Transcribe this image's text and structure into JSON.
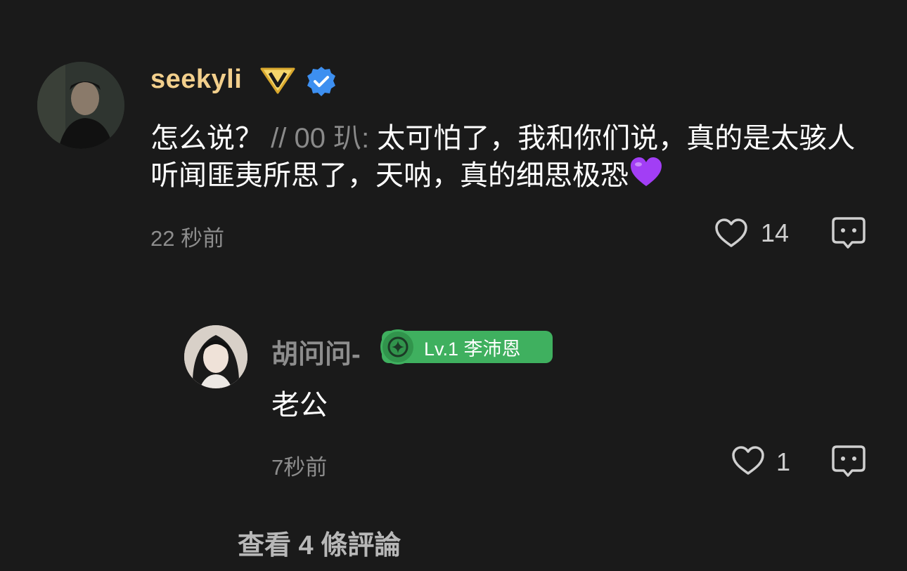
{
  "main_comment": {
    "username": "seekyli",
    "vip_badge_icon": "vip-v-badge-icon",
    "verified_icon": "verified-check-icon",
    "text_main": "怎么说？ ",
    "quote_prefix": "// 00 玐: ",
    "text_quote": "太可怕了，我和你们说，真的是太骇人听闻匪夷所思了，天呐，真的细思极恐",
    "emoji": "purple-heart-emoji",
    "time": "22 秒前",
    "like_count": "14"
  },
  "reply": {
    "username": "胡问问-",
    "level_badge": "Lv.1 李沛恩",
    "text": "老公",
    "time": "7秒前",
    "like_count": "1"
  },
  "view_more": "查看 4 條評論",
  "colors": {
    "background": "#1a1a1a",
    "username_gold": "#f2cf8c",
    "level_green": "#3fb05f",
    "muted": "#8d8d8d"
  }
}
